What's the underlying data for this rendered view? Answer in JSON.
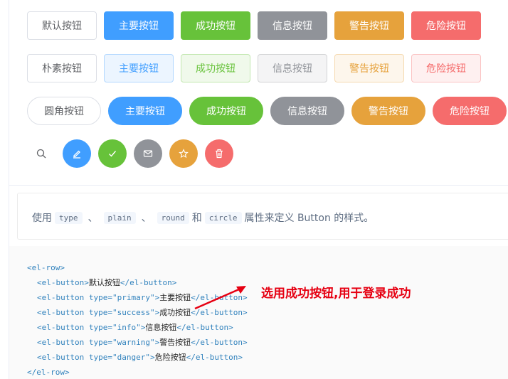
{
  "rows": {
    "default": [
      "默认按钮",
      "主要按钮",
      "成功按钮",
      "信息按钮",
      "警告按钮",
      "危险按钮"
    ],
    "plain": [
      "朴素按钮",
      "主要按钮",
      "成功按钮",
      "信息按钮",
      "警告按钮",
      "危险按钮"
    ],
    "round": [
      "圆角按钮",
      "主要按钮",
      "成功按钮",
      "信息按钮",
      "警告按钮",
      "危险按钮"
    ]
  },
  "circle_icons": [
    "search-icon",
    "edit-icon",
    "check-icon",
    "message-icon",
    "star-icon",
    "delete-icon"
  ],
  "colors": {
    "primary": "#409eff",
    "success": "#67c23a",
    "info": "#909399",
    "warning": "#e6a23c",
    "danger": "#f56c6c",
    "annotation": "#e60012"
  },
  "description": {
    "prefix": "使用",
    "code1": "type",
    "sep1": "、",
    "code2": "plain",
    "sep2": "、",
    "code3": "round",
    "and": "和",
    "code4": "circle",
    "suffix": "属性来定义 Button 的样式。"
  },
  "code": {
    "open_row": "<el-row>",
    "line1": {
      "open": "<el-button>",
      "text": "默认按钮",
      "close": "</el-button>"
    },
    "line2": {
      "open": "<el-button type=\"primary\">",
      "text": "主要按钮",
      "close": "</el-button>"
    },
    "line3": {
      "open": "<el-button type=\"success\">",
      "text": "成功按钮",
      "close": "</el-button>"
    },
    "line4": {
      "open": "<el-button type=\"info\">",
      "text": "信息按钮",
      "close": "</el-button>"
    },
    "line5": {
      "open": "<el-button type=\"warning\">",
      "text": "警告按钮",
      "close": "</el-button>"
    },
    "line6": {
      "open": "<el-button type=\"danger\">",
      "text": "危险按钮",
      "close": "</el-button>"
    },
    "close_row": "</el-row>"
  },
  "annotation": "选用成功按钮,用于登录成功"
}
